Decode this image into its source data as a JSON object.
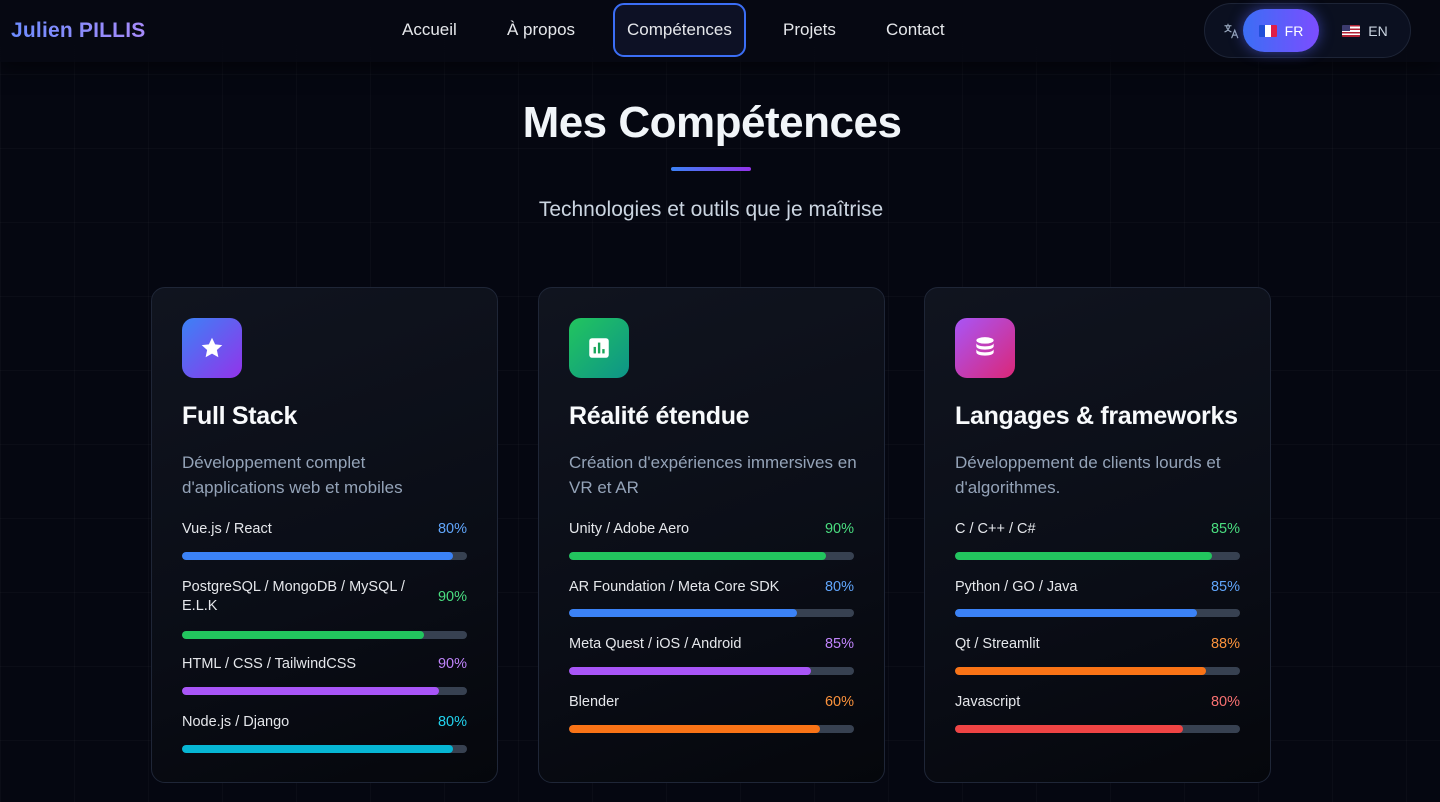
{
  "brand": "Julien PILLIS",
  "nav": {
    "items": [
      {
        "label": "Accueil"
      },
      {
        "label": "À propos"
      },
      {
        "label": "Compétences"
      },
      {
        "label": "Projets"
      },
      {
        "label": "Contact"
      }
    ],
    "active": "Compétences"
  },
  "lang": {
    "fr": "FR",
    "en": "EN",
    "active": "FR"
  },
  "section": {
    "title": "Mes Compétences",
    "subtitle": "Technologies et outils que je maîtrise"
  },
  "colors": {
    "blue": "#3b82f6",
    "green": "#22c55e",
    "purple": "#a855f7",
    "cyan": "#06b6d4",
    "orange": "#f97316",
    "red": "#ef4444",
    "accent_gradient": [
      "#3b82f6",
      "#9333ea"
    ]
  },
  "cards": [
    {
      "title": "Full Stack",
      "icon": "star-icon",
      "description": "Développement complet d'applications web et mobiles",
      "skills": [
        {
          "name": "Vue.js / React",
          "percent_label": "80%",
          "level": 0.95,
          "color": "blue"
        },
        {
          "name": "PostgreSQL / MongoDB / MySQL / E.L.K",
          "percent_label": "90%",
          "level": 0.85,
          "color": "green"
        },
        {
          "name": "HTML / CSS / TailwindCSS",
          "percent_label": "90%",
          "level": 0.9,
          "color": "purple"
        },
        {
          "name": "Node.js / Django",
          "percent_label": "80%",
          "level": 0.95,
          "color": "cyan"
        }
      ]
    },
    {
      "title": "Réalité étendue",
      "icon": "bar-chart-icon",
      "description": "Création d'expériences immersives en VR et AR",
      "skills": [
        {
          "name": "Unity / Adobe Aero",
          "percent_label": "90%",
          "level": 0.9,
          "color": "green"
        },
        {
          "name": "AR Foundation / Meta Core SDK",
          "percent_label": "80%",
          "level": 0.8,
          "color": "blue"
        },
        {
          "name": "Meta Quest / iOS / Android",
          "percent_label": "85%",
          "level": 0.85,
          "color": "purple"
        },
        {
          "name": "Blender",
          "percent_label": "60%",
          "level": 0.88,
          "color": "orange"
        }
      ]
    },
    {
      "title": "Langages & frameworks",
      "icon": "database-icon",
      "description": "Développement de clients lourds et d'algorithmes.",
      "skills": [
        {
          "name": "C / C++ / C#",
          "percent_label": "85%",
          "level": 0.9,
          "color": "green"
        },
        {
          "name": "Python / GO / Java",
          "percent_label": "85%",
          "level": 0.85,
          "color": "blue"
        },
        {
          "name": "Qt / Streamlit",
          "percent_label": "88%",
          "level": 0.88,
          "color": "orange"
        },
        {
          "name": "Javascript",
          "percent_label": "80%",
          "level": 0.8,
          "color": "red"
        }
      ]
    }
  ]
}
